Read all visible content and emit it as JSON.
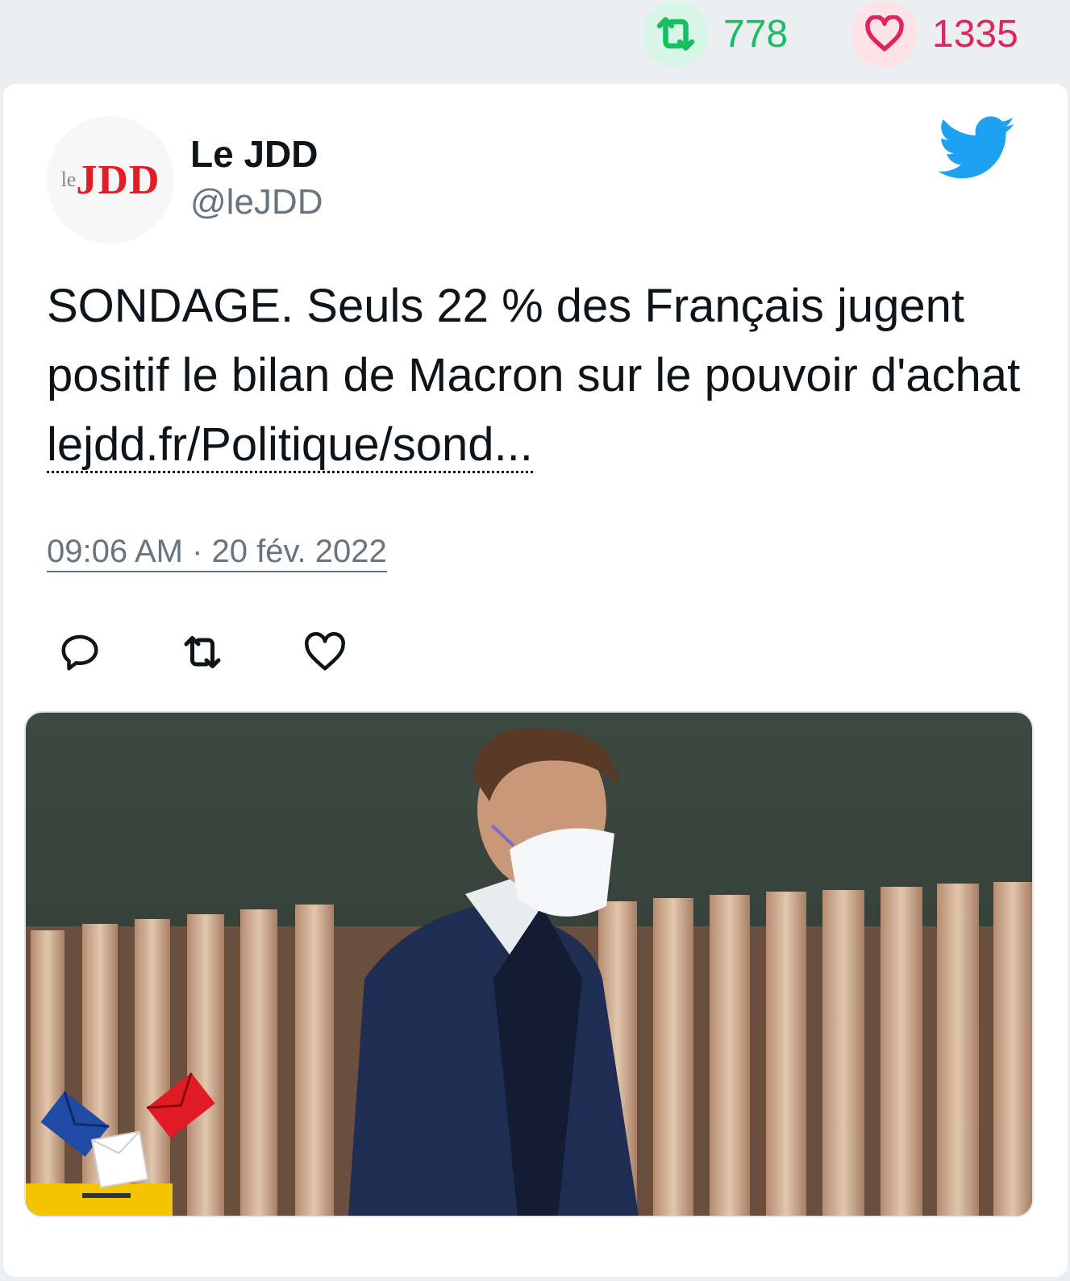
{
  "top_stats": {
    "retweets": "778",
    "likes": "1335",
    "retweet_color": "#17bf63",
    "like_color": "#e0245e"
  },
  "tweet": {
    "author_name": "Le JDD",
    "author_handle": "@leJDD",
    "avatar_logo_text": "leJDD",
    "text": "SONDAGE. Seuls 22 % des Français jugent positif le bilan de Macron sur le pouvoir d'achat ",
    "link": "lejdd.fr/Politique/sond...",
    "timestamp": "09:06 AM · 20 fév. 2022",
    "icons": [
      "twitter-bird-icon",
      "reply-icon",
      "retweet-icon",
      "like-icon"
    ],
    "brand_color": "#1da1f2"
  }
}
